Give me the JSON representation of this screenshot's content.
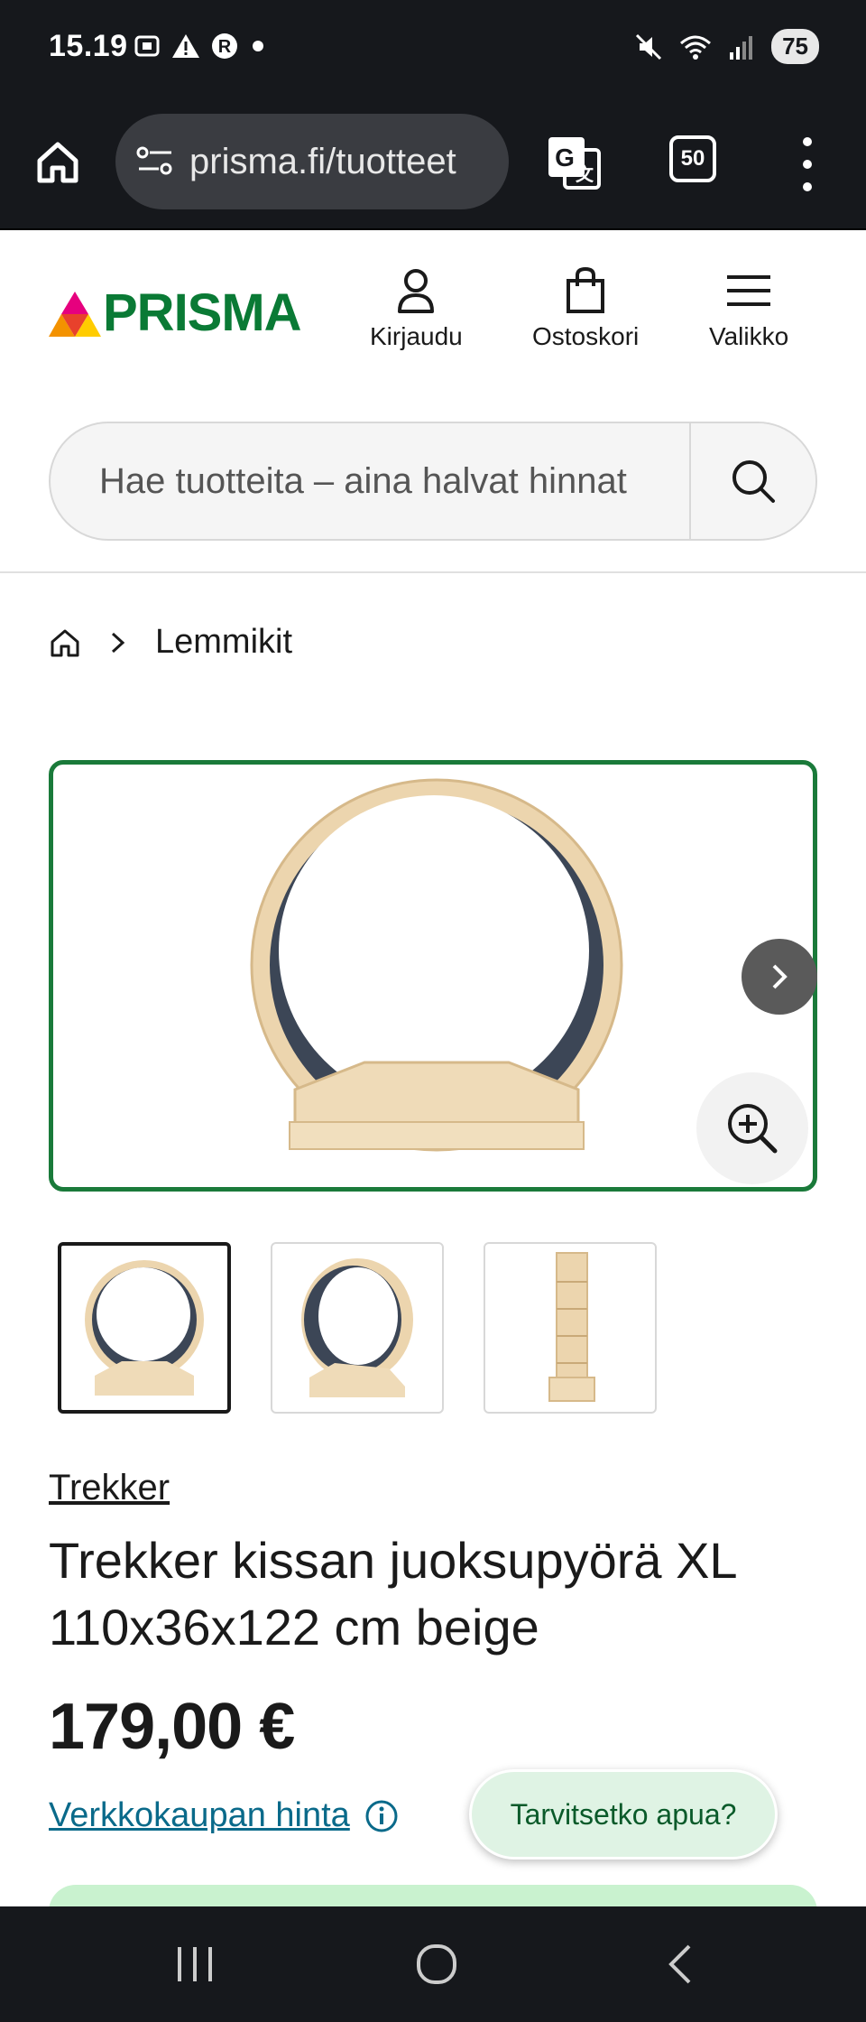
{
  "status_bar": {
    "time": "15.19",
    "battery": "75"
  },
  "browser": {
    "url": "prisma.fi/tuotteet",
    "tab_count": "50"
  },
  "header": {
    "logo_text": "PRISMA",
    "login_label": "Kirjaudu",
    "cart_label": "Ostoskori",
    "menu_label": "Valikko"
  },
  "search": {
    "placeholder": "Hae tuotteita – aina halvat hinnat"
  },
  "breadcrumb": {
    "category": "Lemmikit"
  },
  "product": {
    "brand": "Trekker",
    "title": "Trekker kissan juoksupyörä XL 110x36x122 cm beige",
    "price": "179,00 €",
    "price_note": "Verkkokaupan hinta",
    "thumbnail_count": 3,
    "selected_thumbnail": 1
  },
  "help": {
    "label": "Tarvitsetko apua?"
  },
  "colors": {
    "brand_green": "#0a7a35",
    "image_border": "#1a7a3a",
    "link_blue": "#0a6a8a",
    "help_bg": "#dff3e4"
  }
}
